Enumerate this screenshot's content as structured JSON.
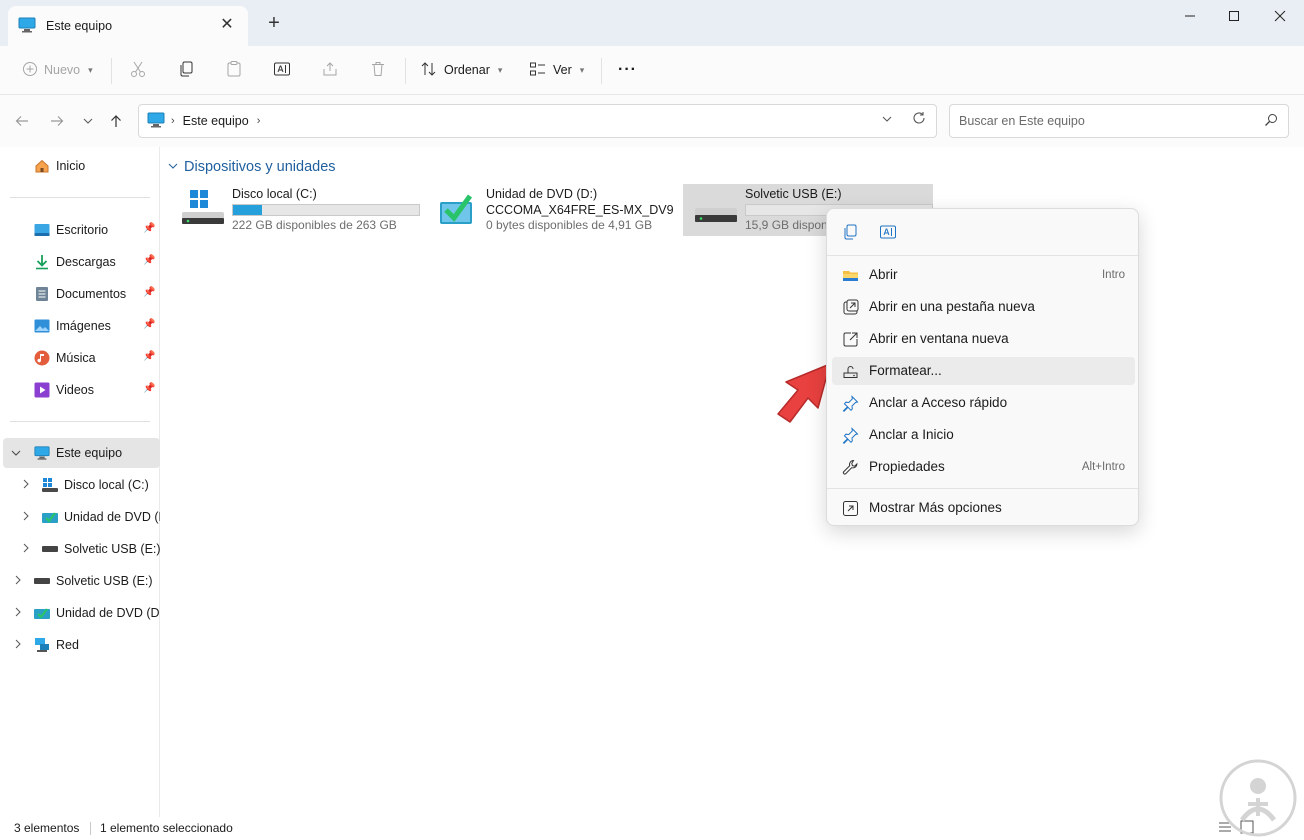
{
  "window": {
    "tab_title": "Este equipo",
    "close_tab": "✕",
    "new_tab": "+",
    "minimize": "—",
    "maximize": "☐",
    "close": "✕"
  },
  "toolbar": {
    "new_label": "Nuevo",
    "sort_label": "Ordenar",
    "view_label": "Ver",
    "more_label": "···"
  },
  "address": {
    "crumb": "Este equipo",
    "search_placeholder": "Buscar en Este equipo"
  },
  "sidebar": {
    "home": "Inicio",
    "quick": [
      {
        "label": "Escritorio",
        "icon": "desktop-icon"
      },
      {
        "label": "Descargas",
        "icon": "downloads-icon"
      },
      {
        "label": "Documentos",
        "icon": "documents-icon"
      },
      {
        "label": "Imágenes",
        "icon": "pictures-icon"
      },
      {
        "label": "Música",
        "icon": "music-icon"
      },
      {
        "label": "Videos",
        "icon": "videos-icon"
      }
    ],
    "tree": [
      {
        "label": "Este equipo"
      },
      {
        "label": "Disco local (C:)"
      },
      {
        "label": "Unidad de DVD (D"
      },
      {
        "label": "Solvetic USB (E:)"
      },
      {
        "label": "Solvetic USB (E:)"
      },
      {
        "label": "Unidad de DVD (D:)"
      },
      {
        "label": "Red"
      }
    ]
  },
  "content": {
    "group_title": "Dispositivos y unidades",
    "drives": [
      {
        "name": "Disco local (C:)",
        "info": "222 GB disponibles de 263 GB",
        "used_fraction": 0.156
      },
      {
        "name": "Unidad de DVD (D:)",
        "name2": "CCCOMA_X64FRE_ES-MX_DV9",
        "info": "0 bytes disponibles de 4,91 GB"
      },
      {
        "name": "Solvetic USB (E:)",
        "info": "15,9 GB disponib",
        "used_fraction": 0.0
      }
    ]
  },
  "context_menu": {
    "items": [
      {
        "label": "Abrir",
        "shortcut": "Intro"
      },
      {
        "label": "Abrir en una pestaña nueva",
        "shortcut": ""
      },
      {
        "label": "Abrir en ventana nueva",
        "shortcut": ""
      },
      {
        "label": "Formatear...",
        "shortcut": ""
      },
      {
        "label": "Anclar a Acceso rápido",
        "shortcut": ""
      },
      {
        "label": "Anclar a Inicio",
        "shortcut": ""
      },
      {
        "label": "Propiedades",
        "shortcut": "Alt+Intro"
      },
      {
        "label": "Mostrar Más opciones",
        "shortcut": ""
      }
    ]
  },
  "status": {
    "count": "3 elementos",
    "selection": "1 elemento seleccionado"
  },
  "colors": {
    "accent": "#0067c0",
    "drive_fill": "#26a0da",
    "arrow": "#e8413f"
  }
}
